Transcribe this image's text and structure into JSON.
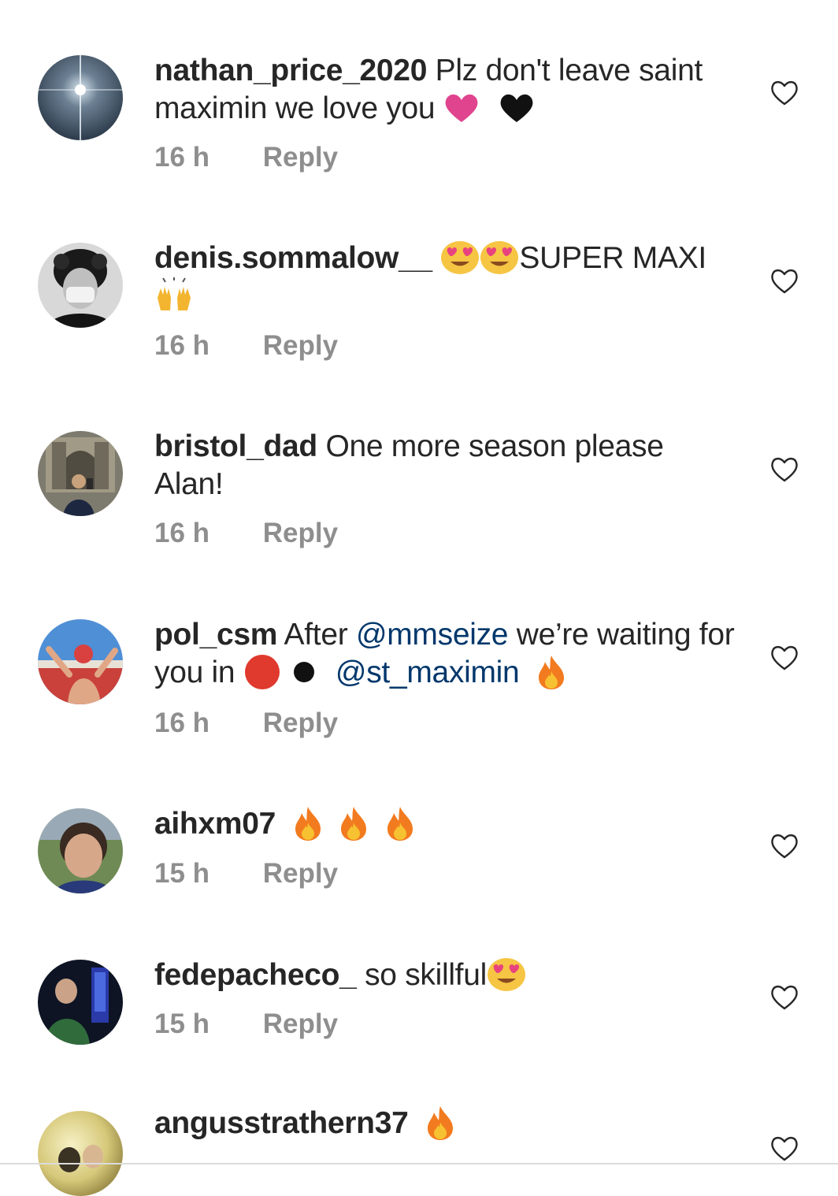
{
  "comments": [
    {
      "username": "nathan_price_2020",
      "text": "Plz don't leave saint maximin we love you",
      "emoji": [
        "pink-heart",
        "black-heart"
      ],
      "time": "16 h",
      "reply": "Reply"
    },
    {
      "username": "denis.sommalow__",
      "emoji_before": [
        "heart-eyes",
        "heart-eyes"
      ],
      "text": "SUPER MAXI",
      "emoji_after": [
        "raising-hands"
      ],
      "time": "16 h",
      "reply": "Reply"
    },
    {
      "username": "bristol_dad",
      "text": "One more season please Alan!",
      "time": "16 h",
      "reply": "Reply"
    },
    {
      "username": "pol_csm",
      "text_before": "After",
      "mention_1": "@mmseize",
      "text_middle": "we’re waiting for you in",
      "emoji_middle": [
        "red-circle",
        "black-circle"
      ],
      "mention_2": "@st_maximin",
      "emoji_after": [
        "fire"
      ],
      "time": "16 h",
      "reply": "Reply"
    },
    {
      "username": "aihxm07",
      "emoji": [
        "fire",
        "fire",
        "fire"
      ],
      "time": "15 h",
      "reply": "Reply"
    },
    {
      "username": "fedepacheco_",
      "text": "so skillful",
      "emoji": [
        "heart-eyes"
      ],
      "time": "15 h",
      "reply": "Reply"
    },
    {
      "username": "angusstrathern37",
      "emoji": [
        "fire"
      ]
    }
  ],
  "colors": {
    "text": "#262626",
    "meta": "#8e8e8e",
    "mention": "#00376b",
    "heart_outline": "#262626"
  },
  "icons": {
    "like": "heart-outline-icon"
  }
}
